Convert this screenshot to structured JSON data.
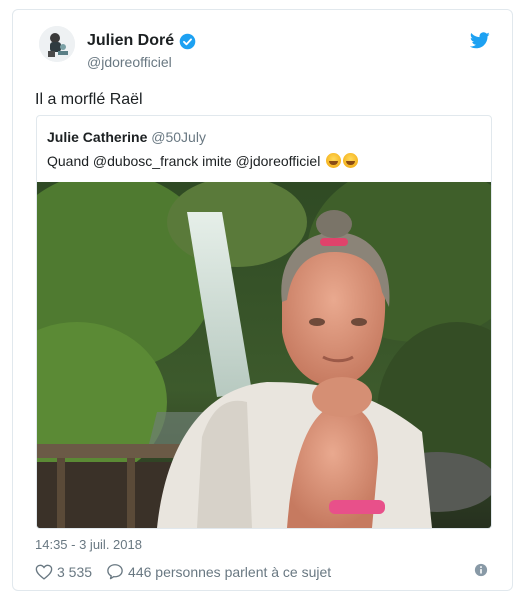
{
  "author": {
    "name": "Julien Doré",
    "handle": "@jdoreofficiel"
  },
  "tweet": {
    "text": "Il a morflé Raël",
    "timestamp": "14:35 - 3 juil. 2018"
  },
  "quoted": {
    "author_name": "Julie Catherine",
    "author_handle": "@50July",
    "text": "Quand @dubosc_franck imite @jdoreofficiel"
  },
  "actions": {
    "likes": "3 535",
    "conversation": "446 personnes parlent à ce sujet"
  },
  "icons": {
    "brand": "twitter-bird-icon",
    "verified": "verified-badge-icon",
    "like": "heart-icon",
    "reply": "comment-bubble-icon",
    "info": "info-icon"
  },
  "colors": {
    "accent": "#1da1f2",
    "text": "#1c2022",
    "muted": "#697882",
    "border": "#e1e8ed"
  }
}
